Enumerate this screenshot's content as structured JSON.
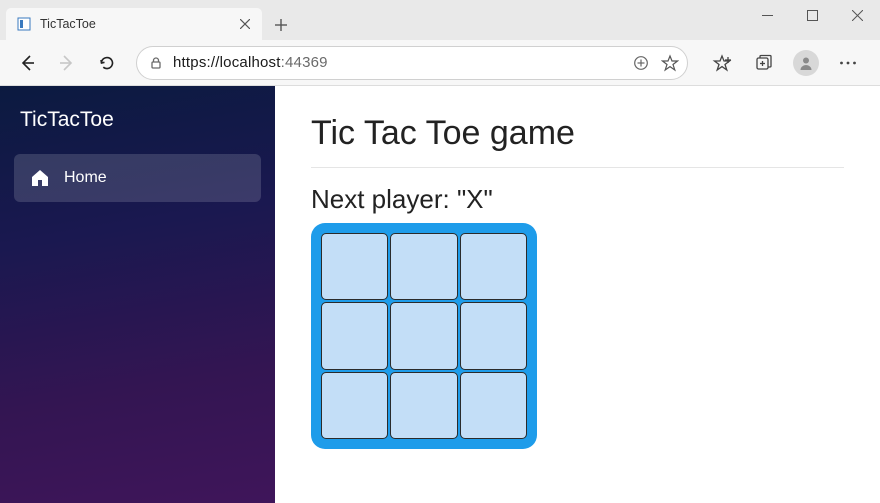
{
  "browser": {
    "tab_title": "TicTacToe",
    "url_host": "https://localhost",
    "url_port": ":44369"
  },
  "sidebar": {
    "brand": "TicTacToe",
    "items": [
      {
        "label": "Home"
      }
    ]
  },
  "main": {
    "heading": "Tic Tac Toe game",
    "status": "Next player: \"X\"",
    "board": {
      "cells": [
        "",
        "",
        "",
        "",
        "",
        "",
        "",
        "",
        ""
      ]
    }
  }
}
